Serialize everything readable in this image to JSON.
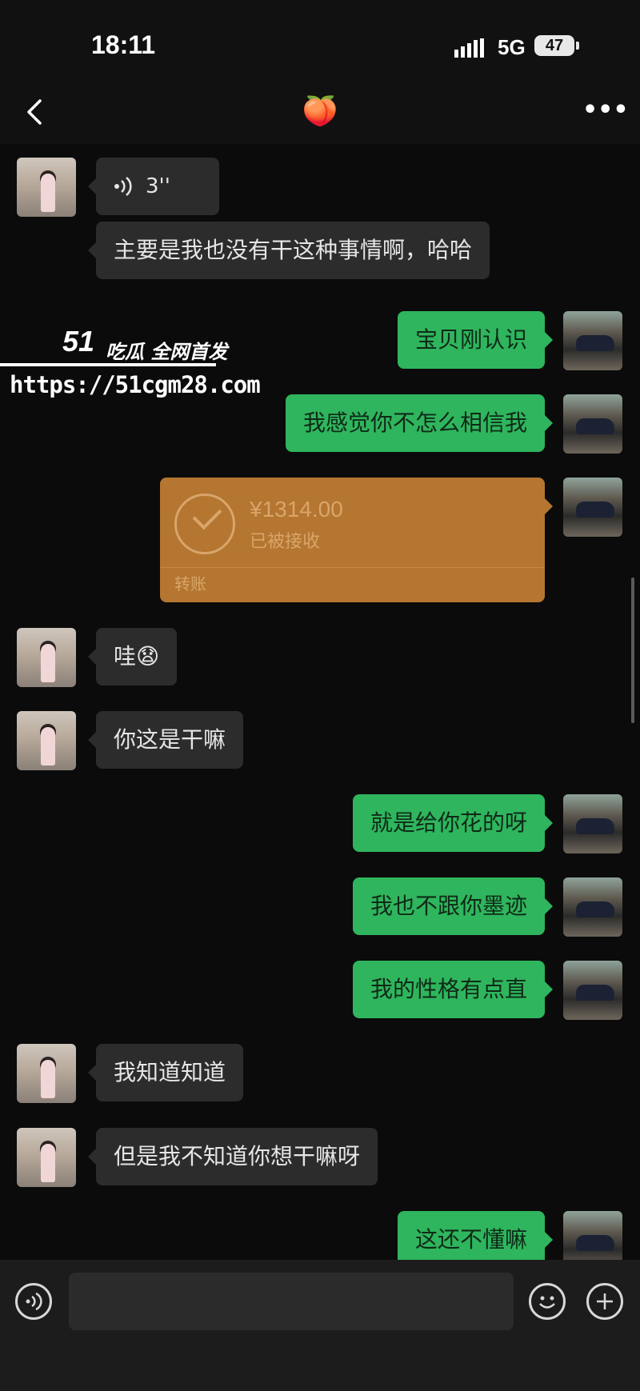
{
  "status_bar": {
    "time": "18:11",
    "network": "5G",
    "battery": "47"
  },
  "nav": {
    "title": "🍑",
    "back_icon": "chevron-left-icon",
    "more_label": "•••"
  },
  "messages": [
    {
      "side": "in",
      "type": "voice",
      "duration": "3''"
    },
    {
      "side": "in",
      "type": "text",
      "text": "主要是我也没有干这种事情啊，哈哈"
    },
    {
      "side": "out",
      "type": "text",
      "text": "宝贝刚认识"
    },
    {
      "side": "out",
      "type": "text",
      "text": "我感觉你不怎么相信我"
    },
    {
      "side": "out",
      "type": "transfer",
      "amount": "¥1314.00",
      "status": "已被接收",
      "label": "转账"
    },
    {
      "side": "in",
      "type": "text",
      "text": "哇😧"
    },
    {
      "side": "in",
      "type": "text",
      "text": "你这是干嘛"
    },
    {
      "side": "out",
      "type": "text",
      "text": "就是给你花的呀"
    },
    {
      "side": "out",
      "type": "text",
      "text": "我也不跟你墨迹"
    },
    {
      "side": "out",
      "type": "text",
      "text": "我的性格有点直"
    },
    {
      "side": "in",
      "type": "text",
      "text": "我知道知道"
    },
    {
      "side": "in",
      "type": "text",
      "text": "但是我不知道你想干嘛呀"
    },
    {
      "side": "out",
      "type": "text",
      "text": "这还不懂嘛"
    }
  ],
  "watermark": {
    "title": "51",
    "subtitle": "吃瓜 全网首发",
    "url": "https://51cgm28.com"
  },
  "input_bar": {
    "voice_icon": "voice-icon",
    "emoji_icon": "emoji-icon",
    "plus_icon": "plus-icon"
  },
  "colors": {
    "outgoing": "#2fb55d",
    "incoming": "#2c2c2c",
    "transfer": "#b47630",
    "background": "#0b0b0b"
  }
}
